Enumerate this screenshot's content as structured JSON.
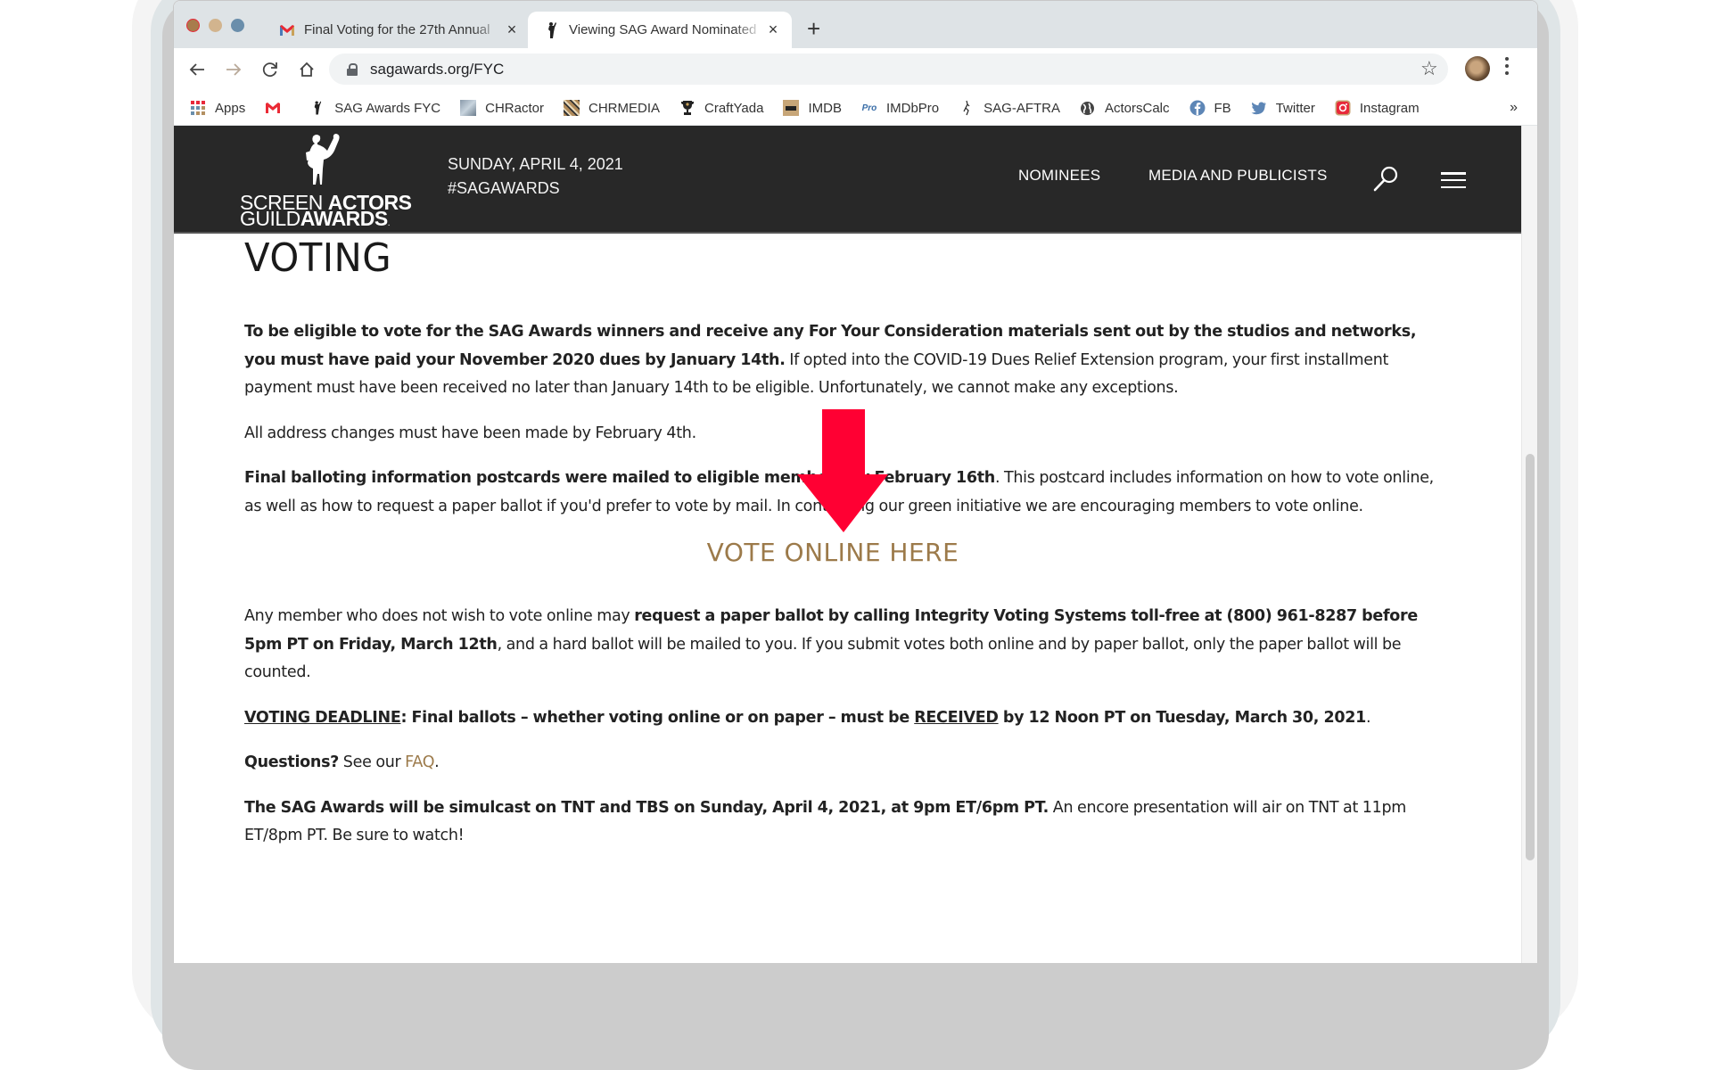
{
  "browser": {
    "tabs": [
      {
        "favicon": "gmail-icon",
        "title": "Final Voting for the 27th Annual",
        "active": false
      },
      {
        "favicon": "sag-statuette-icon",
        "title": "Viewing SAG Award Nominated",
        "active": true
      }
    ],
    "new_tab_label": "+",
    "close_glyph": "×",
    "url": "sagawards.org/FYC",
    "bookmarks": [
      {
        "icon": "apps-grid-icon",
        "label": "Apps"
      },
      {
        "icon": "gmail-icon",
        "label": ""
      },
      {
        "icon": "sag-statuette-icon",
        "label": "SAG Awards FYC"
      },
      {
        "icon": "chractor-eye-icon",
        "label": "CHRactor"
      },
      {
        "icon": "chrmedia-icon",
        "label": "CHRMEDIA"
      },
      {
        "icon": "trophy-icon",
        "label": "CraftYada"
      },
      {
        "icon": "imdb-icon",
        "label": "IMDB"
      },
      {
        "icon": "imdbpro-icon",
        "label": "IMDbPro"
      },
      {
        "icon": "sag-aftra-icon",
        "label": "SAG-AFTRA"
      },
      {
        "icon": "globe-icon",
        "label": "ActorsCalc"
      },
      {
        "icon": "facebook-icon",
        "label": "FB"
      },
      {
        "icon": "twitter-icon",
        "label": "Twitter"
      },
      {
        "icon": "instagram-icon",
        "label": "Instagram"
      }
    ],
    "bookmarks_overflow": "»"
  },
  "site": {
    "logo": {
      "line1_light": "SCREEN",
      "line1_bold": "ACTORS",
      "line2_light": "GUILD",
      "line2_bold": "AWARDS",
      "mark": "."
    },
    "date": "SUNDAY, APRIL 4, 2021",
    "hashtag": "#SAGAWARDS",
    "nav": [
      "NOMINEES",
      "MEDIA AND PUBLICISTS"
    ],
    "colors": {
      "header_bg": "#282828",
      "link_gold": "#9c7a4a",
      "annotation_red": "#ff0033"
    }
  },
  "content": {
    "title": "VOTING",
    "p1": {
      "bold": "To be eligible to vote for the SAG Awards winners and receive any For Your Consideration materials sent out by the studios and networks, you must have paid your November 2020 dues by January 14th.",
      "normal": "  If opted into the COVID-19 Dues Relief Extension program, your first installment payment must have been received no later than  January 14th to be eligible. Unfortunately, we cannot make any exceptions."
    },
    "p2": "All address changes must have been made by February 4th.",
    "p3": {
      "bold": "Final balloting information postcards were mailed to eligible members by February 16th",
      "normal": ".  This postcard includes information on how to vote online, as well as how to request a paper ballot if you'd prefer to vote by mail. In continuing our green initiative we are encouraging members to vote online."
    },
    "vote_link": "VOTE ONLINE HERE",
    "p4": {
      "normal1": "Any member who does not wish to vote online may ",
      "bold": "request a paper ballot by calling Integrity Voting Systems toll-free at (800) 961-8287 before 5pm PT on Friday, March 12th",
      "normal2": ", and a hard ballot will be mailed to you. If you submit votes both online and by paper ballot, only the paper ballot will be counted."
    },
    "p5": {
      "deadline_label": "VOTING DEADLINE",
      "bold1": ": Final ballots – whether voting online or on paper – must be ",
      "received": "RECEIVED",
      "bold2": " by 12 Noon PT on Tuesday, March 30, 2021",
      "end": "."
    },
    "p6": {
      "bold": "Questions?",
      "normal": " See our ",
      "link": "FAQ",
      "end": "."
    },
    "p7": {
      "bold": "The SAG Awards will be simulcast on TNT and TBS on Sunday, April 4, 2021, at 9pm ET/6pm PT.",
      "normal": "  An encore presentation will air on TNT at 11pm ET/8pm PT.  Be sure to watch!"
    }
  },
  "annotation": {
    "type": "arrow-down",
    "points_to": "VOTE ONLINE HERE"
  }
}
